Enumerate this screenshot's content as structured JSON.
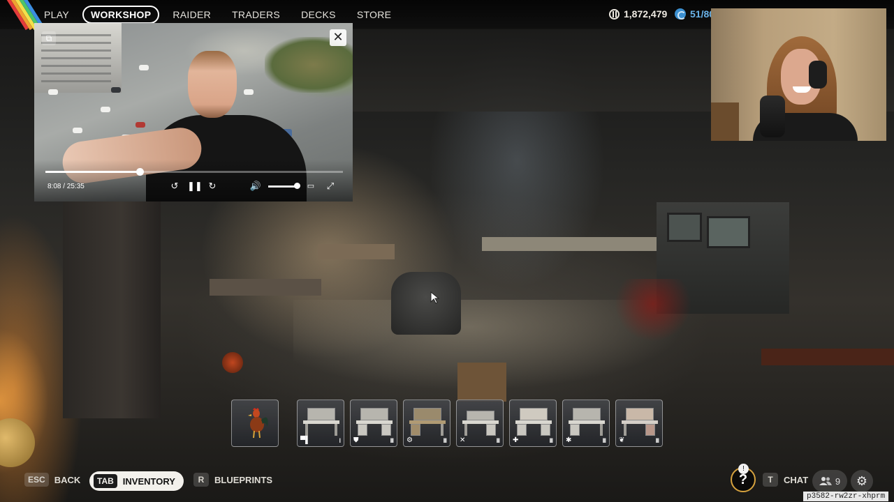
{
  "nav": {
    "items": [
      {
        "label": "PLAY",
        "active": false
      },
      {
        "label": "WORKSHOP",
        "active": true
      },
      {
        "label": "RAIDER",
        "active": false
      },
      {
        "label": "TRADERS",
        "active": false
      },
      {
        "label": "DECKS",
        "active": false
      },
      {
        "label": "STORE",
        "active": false
      }
    ],
    "coins": "1,872,479",
    "seeds": "51/80",
    "brand_colors": [
      "#e23b3b",
      "#f0a132",
      "#f3e04b",
      "#4cc46a",
      "#3b8de0"
    ]
  },
  "pip_video": {
    "time": "8:08 / 25:35",
    "progress": 0.317,
    "volume": 0.9,
    "icons": [
      "expand-icon",
      "close-icon",
      "rewind-10-icon",
      "pause-icon",
      "forward-10-icon",
      "volume-icon",
      "captions-icon",
      "fullscreen-icon"
    ]
  },
  "hotbar": {
    "slots": [
      {
        "name": "rooster",
        "icon": "rooster-icon",
        "tier": ""
      },
      {
        "name": "bench-1",
        "icon": "bench-icon",
        "tier": "I"
      },
      {
        "name": "bench-2",
        "icon": "shield-icon",
        "tier": "III"
      },
      {
        "name": "bench-3",
        "icon": "gear-icon",
        "tier": "III"
      },
      {
        "name": "bench-4",
        "icon": "crossed-tools-icon",
        "tier": "III"
      },
      {
        "name": "bench-5",
        "icon": "medical-icon",
        "tier": "III"
      },
      {
        "name": "bench-6",
        "icon": "explosive-icon",
        "tier": "III"
      },
      {
        "name": "bench-7",
        "icon": "plant-icon",
        "tier": "III"
      }
    ]
  },
  "bottom": {
    "back": {
      "key": "ESC",
      "label": "BACK"
    },
    "inventory": {
      "key": "TAB",
      "label": "INVENTORY"
    },
    "blueprints": {
      "key": "R",
      "label": "BLUEPRINTS"
    },
    "chat": {
      "key": "T",
      "label": "CHAT"
    },
    "party_count": "9",
    "help_label": "?"
  },
  "session_id": "p3582-rw2zr-xhprm",
  "colors": {
    "seed_accent": "#6ab4ea",
    "help_ring": "#d6a23e"
  }
}
